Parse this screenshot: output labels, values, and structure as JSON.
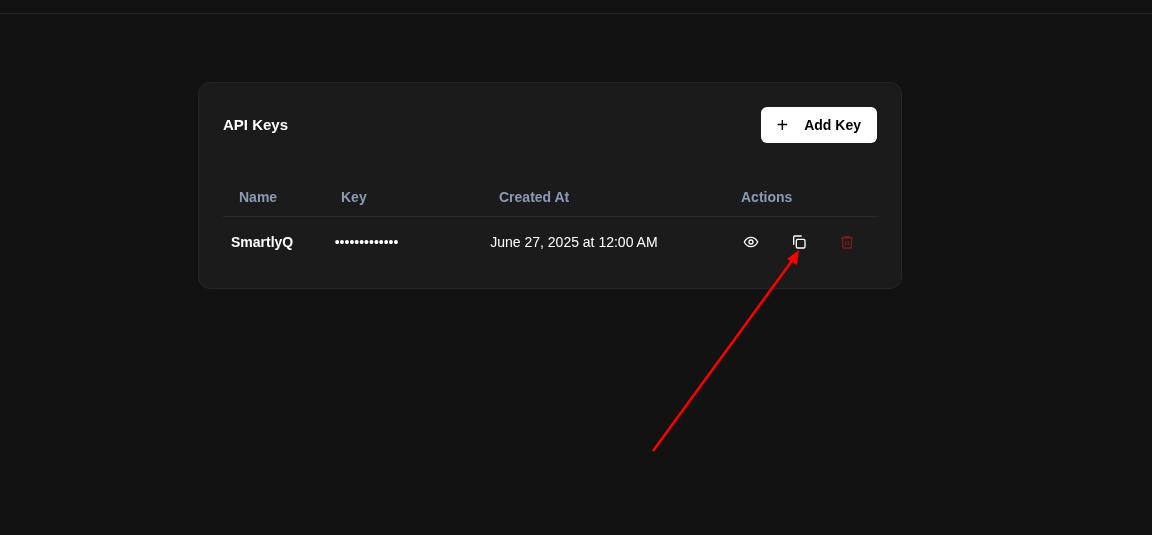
{
  "card": {
    "title": "API Keys",
    "add_button": {
      "icon": "+",
      "label": "Add Key"
    }
  },
  "table": {
    "columns": [
      "Name",
      "Key",
      "Created At",
      "Actions"
    ],
    "rows": [
      {
        "name": "SmartlyQ",
        "key": "•••••••••••••",
        "created_at": "June 27, 2025 at 12:00 AM"
      }
    ]
  }
}
